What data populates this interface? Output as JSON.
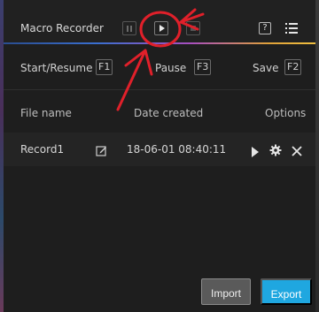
{
  "app": {
    "title": "Macro Recorder"
  },
  "toolbar": {
    "pause_icon": "pause-icon",
    "play_icon": "play-icon",
    "stop_icon": "stop-icon",
    "help_label": "?",
    "menu_icon": "list-menu-icon"
  },
  "hotkeys": {
    "start_label": "Start/Resume",
    "start_key": "F1",
    "pause_label": "Pause",
    "pause_key": "F3",
    "save_label": "Save",
    "save_key": "F2"
  },
  "table": {
    "headers": {
      "name": "File name",
      "date": "Date created",
      "options": "Options"
    },
    "rows": [
      {
        "name": "Record1",
        "date": "18-06-01 08:40:11"
      }
    ]
  },
  "footer": {
    "import_label": "Import",
    "export_label": "Export"
  },
  "colors": {
    "accent": "#1fa7e0",
    "annotation": "#e0202a"
  }
}
